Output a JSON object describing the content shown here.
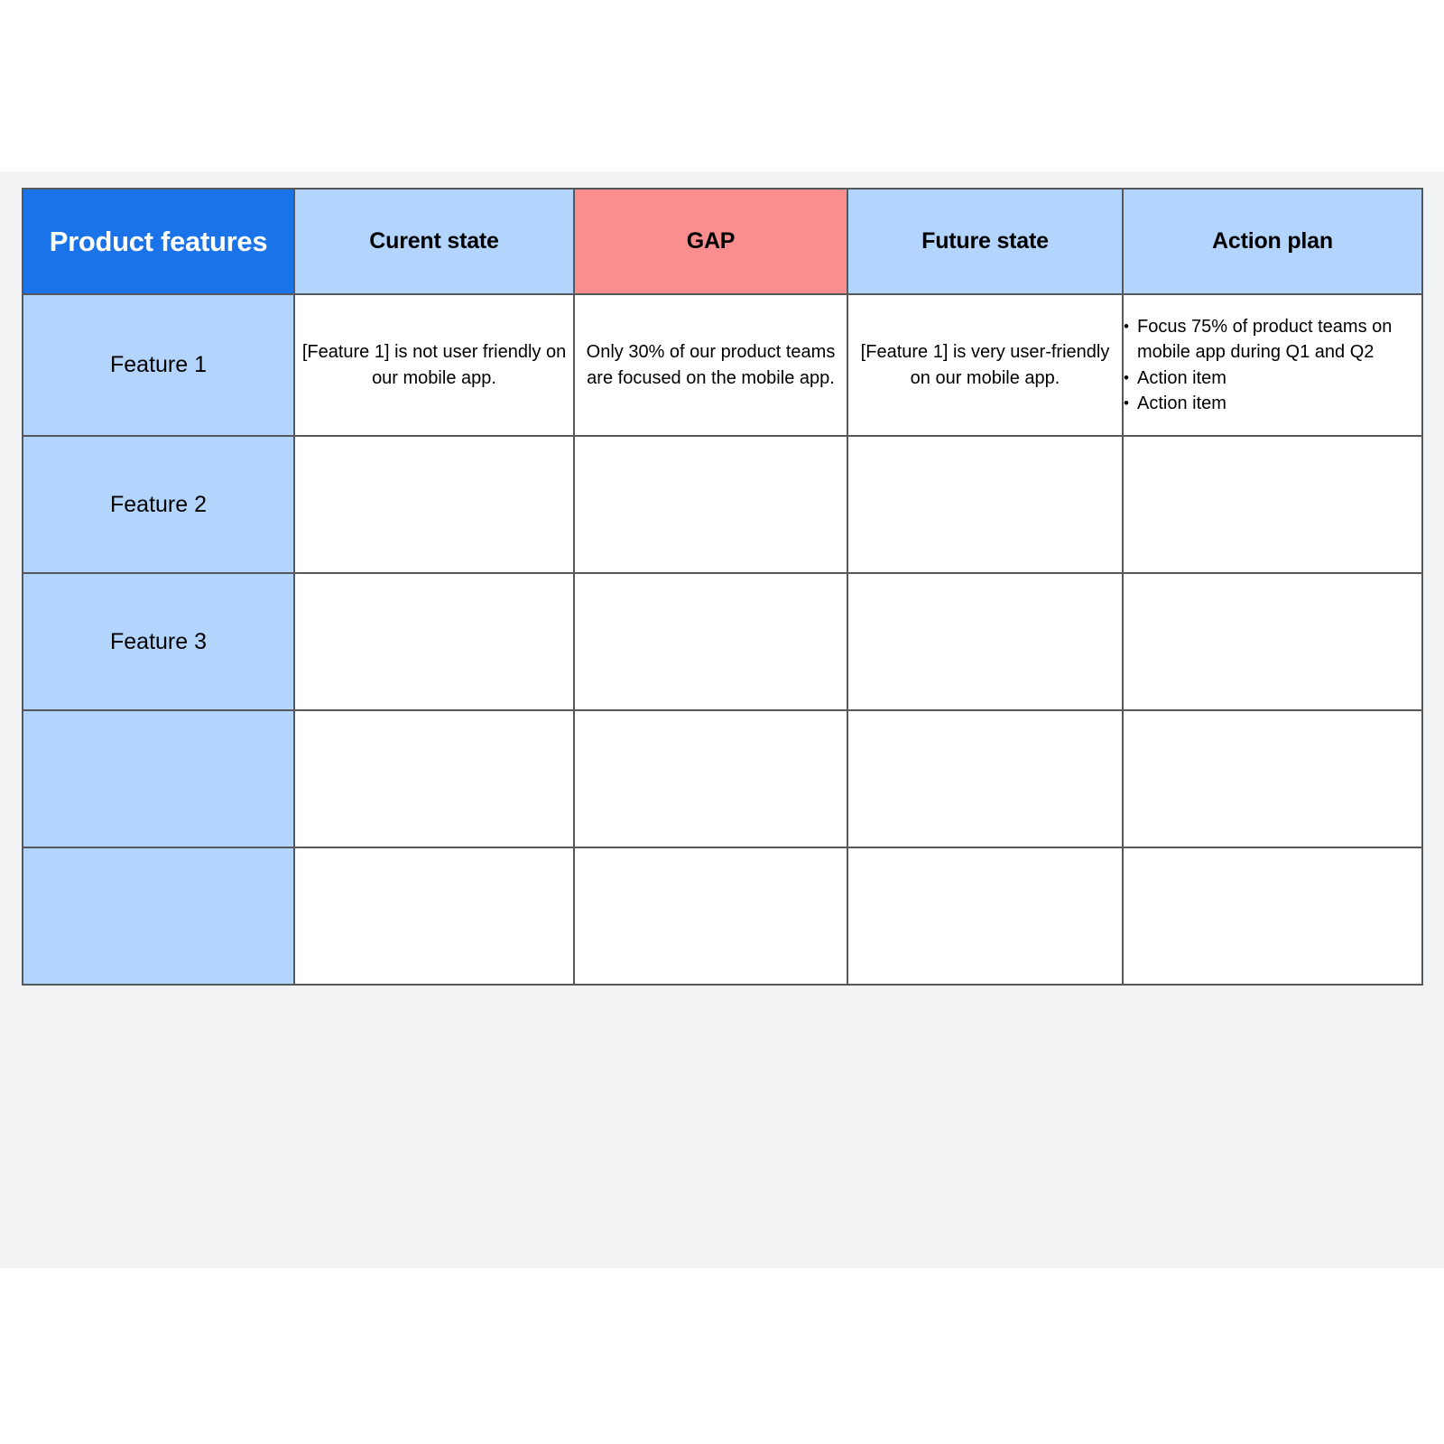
{
  "canvas": {
    "background_color": "#f1f3f4",
    "page_background_color": "#ffffff"
  },
  "table": {
    "name": "gap-analysis-table",
    "colors": {
      "header_primary_bg": "#1a73e8",
      "header_primary_text": "#ffffff",
      "header_bg": "#b3d4fd",
      "header_gap_bg": "#fa8e8e",
      "row_label_bg": "#b3d4fd",
      "cell_bg": "#ffffff",
      "border": "#555759",
      "text": "#000000"
    },
    "columns": [
      {
        "key": "feature",
        "label": "Product features",
        "style": "primary"
      },
      {
        "key": "current",
        "label": "Curent state",
        "style": "default"
      },
      {
        "key": "gap",
        "label": "GAP",
        "style": "gap"
      },
      {
        "key": "future",
        "label": "Future state",
        "style": "default"
      },
      {
        "key": "action",
        "label": "Action plan",
        "style": "default"
      }
    ],
    "rows": [
      {
        "feature": "Feature 1",
        "current": "[Feature 1] is not user friendly on our mobile app.",
        "gap": "Only 30% of our product teams are focused on the mobile app.",
        "future": "[Feature 1] is very user-friendly on our mobile app.",
        "action_items": [
          "Focus 75% of product teams on mobile app during Q1 and Q2",
          "Action item",
          "Action item"
        ]
      },
      {
        "feature": "Feature 2",
        "current": "",
        "gap": "",
        "future": "",
        "action_items": []
      },
      {
        "feature": "Feature 3",
        "current": "",
        "gap": "",
        "future": "",
        "action_items": []
      },
      {
        "feature": "",
        "current": "",
        "gap": "",
        "future": "",
        "action_items": []
      },
      {
        "feature": "",
        "current": "",
        "gap": "",
        "future": "",
        "action_items": []
      }
    ]
  }
}
